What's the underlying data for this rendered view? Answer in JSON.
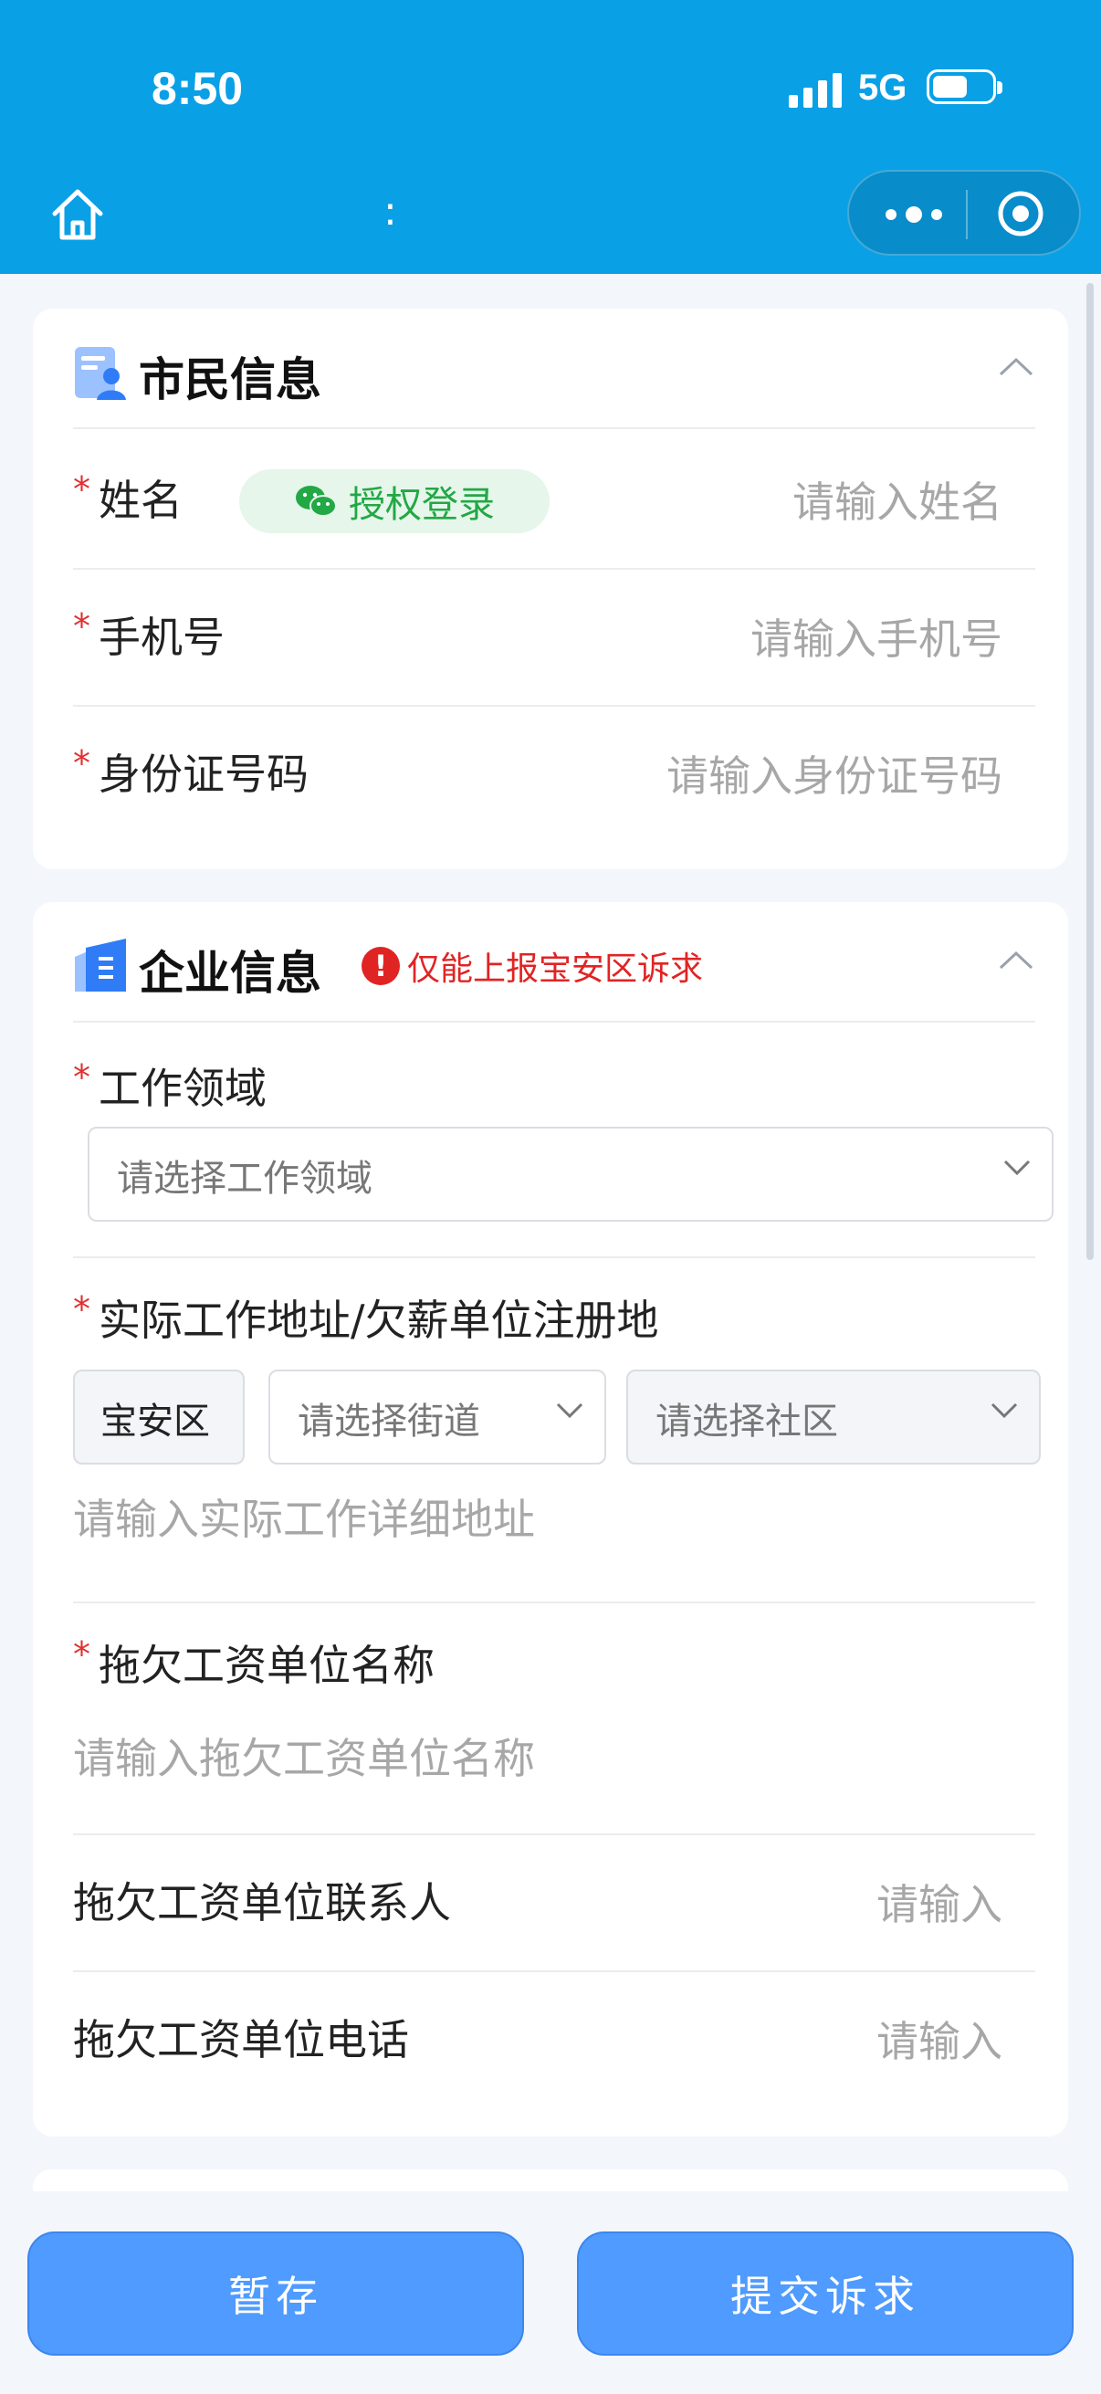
{
  "status": {
    "time": "8:50",
    "network": "5G"
  },
  "nav": {
    "title": ":"
  },
  "citizen": {
    "title": "市民信息",
    "name_label": "姓名",
    "auth_label": "授权登录",
    "name_placeholder": "请输入姓名",
    "phone_label": "手机号",
    "phone_placeholder": "请输入手机号",
    "id_label": "身份证号码",
    "id_placeholder": "请输入身份证号码"
  },
  "company": {
    "title": "企业信息",
    "notice": "仅能上报宝安区诉求",
    "field_label": "工作领域",
    "field_placeholder": "请选择工作领域",
    "address_label": "实际工作地址/欠薪单位注册地",
    "district": "宝安区",
    "street_placeholder": "请选择街道",
    "community_placeholder": "请选择社区",
    "address_detail_placeholder": "请输入实际工作详细地址",
    "unit_name_label": "拖欠工资单位名称",
    "unit_name_placeholder": "请输入拖欠工资单位名称",
    "contact_label": "拖欠工资单位联系人",
    "contact_placeholder": "请输入",
    "phone_label": "拖欠工资单位电话",
    "phone_placeholder": "请输入"
  },
  "actions": {
    "save_label": "暂存",
    "submit_label": "提交诉求"
  },
  "colors": {
    "header": "#0aa0e6",
    "button": "#4f9bff",
    "required": "#e03131",
    "wechat": "#22a845"
  }
}
